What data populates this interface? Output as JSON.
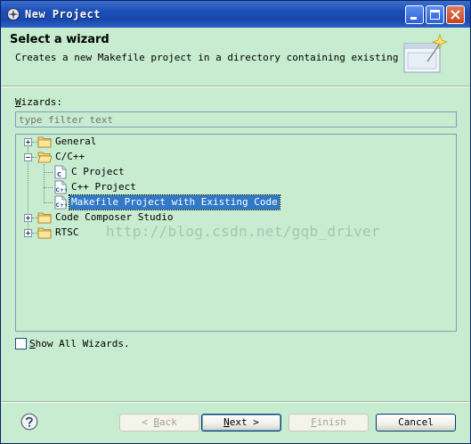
{
  "window": {
    "title": "New Project",
    "title_bar_color": "#1c4eb8",
    "background_color": "#c7ecd0"
  },
  "header": {
    "title": "Select a wizard",
    "description": "Creates a new Makefile project in a directory containing existing code",
    "banner_icon": "wizard-banner-icon"
  },
  "wizards": {
    "label_mnemonic": "W",
    "label_rest": "izards:",
    "filter_placeholder": "type filter text"
  },
  "tree": {
    "general": {
      "label": "General",
      "expanded": false
    },
    "cpp": {
      "label": "C/C++",
      "expanded": true,
      "children": {
        "c_project": "C Project",
        "cpp_project": "C++ Project",
        "makefile_existing": "Makefile Project with Existing Code"
      },
      "selected": "makefile_existing"
    },
    "ccs": {
      "label": "Code Composer Studio",
      "expanded": false
    },
    "rtsc": {
      "label": "RTSC",
      "expanded": false
    }
  },
  "watermark": "http://blog.csdn.net/gqb_driver",
  "show_all": {
    "mnemonic": "S",
    "rest": "how All Wizards.",
    "checked": false
  },
  "buttons": {
    "back": {
      "prefix": "< ",
      "mnemonic": "B",
      "rest": "ack",
      "enabled": false
    },
    "next": {
      "mnemonic": "N",
      "rest": "ext >",
      "enabled": true
    },
    "finish": {
      "mnemonic": "F",
      "rest": "inish",
      "enabled": false
    },
    "cancel": {
      "label": "Cancel",
      "enabled": true
    }
  },
  "accent_color": "#3178c6"
}
